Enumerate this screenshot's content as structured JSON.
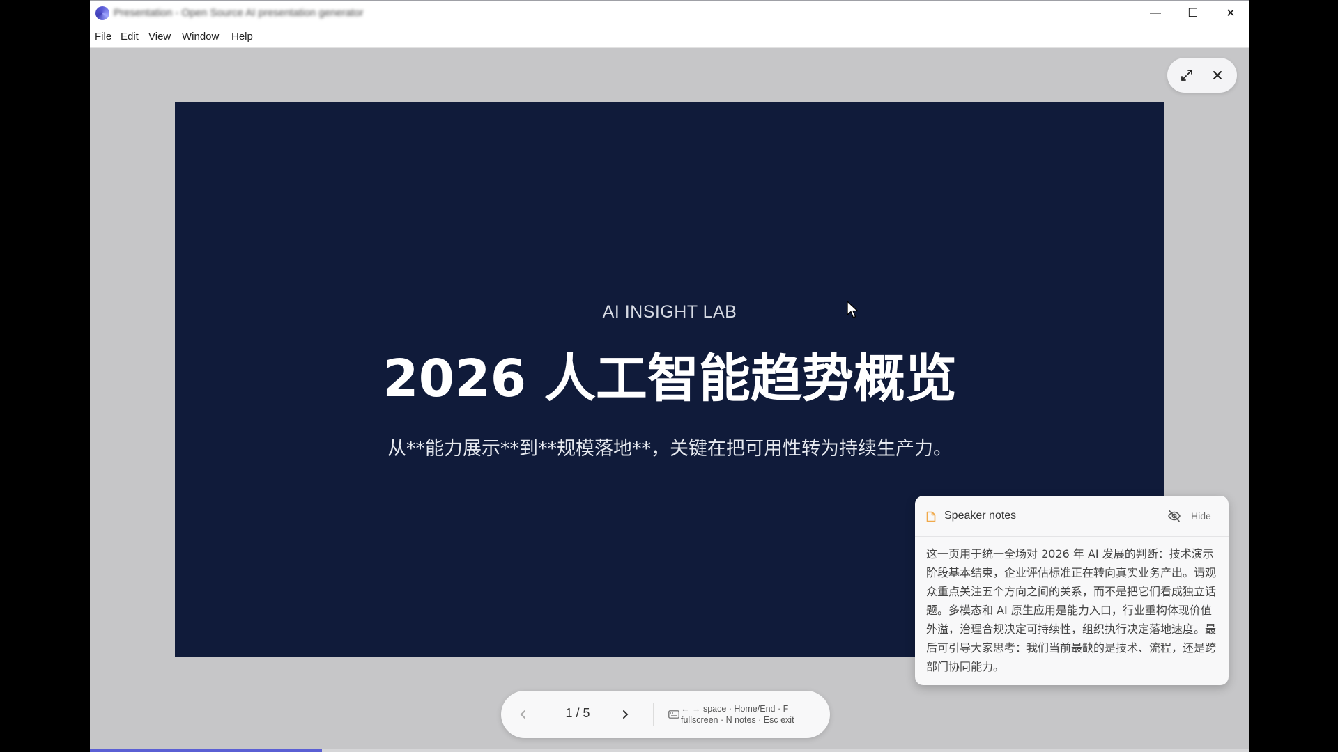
{
  "window": {
    "title": "Presentation - Open Source AI presentation generator",
    "controls": {
      "minimize": "—",
      "maximize": "☐",
      "close": "✕"
    }
  },
  "menu": [
    "File",
    "Edit",
    "View",
    "Window",
    "Help"
  ],
  "slide": {
    "brand": "AI INSIGHT LAB",
    "title": "2026 人工智能趋势概览",
    "subtitle": "从**能力展示**到**规模落地**，关键在把可用性转为持续生产力。"
  },
  "notes": {
    "header": "Speaker notes",
    "hide_label": "Hide",
    "body": "这一页用于统一全场对 2026 年 AI 发展的判断：技术演示阶段基本结束，企业评估标准正在转向真实业务产出。请观众重点关注五个方向之间的关系，而不是把它们看成独立话题。多模态和 AI 原生应用是能力入口，行业重构体现价值外溢，治理合规决定可持续性，组织执行决定落地速度。最后可引导大家思考：我们当前最缺的是技术、流程，还是跨部门协同能力。"
  },
  "nav": {
    "page_indicator": "1 / 5",
    "hint": "← → space · Home/End · F fullscreen · N notes · Esc exit"
  },
  "progress": {
    "current": 1,
    "total": 5,
    "fraction": 0.2
  },
  "colors": {
    "slide_bg": "#101b3a",
    "accent": "#5a5fd4",
    "notes_icon": "#f0a94a"
  },
  "icons": [
    "fullscreen-icon",
    "close-icon",
    "notes-icon",
    "eye-off-icon",
    "chevron-left-icon",
    "chevron-right-icon",
    "keyboard-icon"
  ]
}
